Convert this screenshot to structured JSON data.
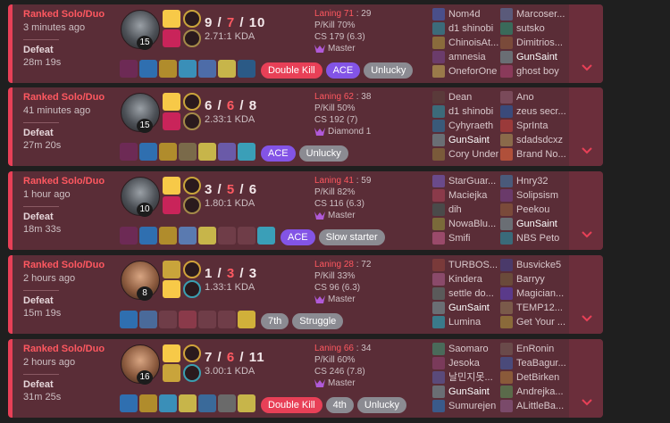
{
  "matches": [
    {
      "queue": "Ranked Solo/Duo",
      "ago": "3 minutes ago",
      "result": "Defeat",
      "duration": "28m 19s",
      "champ_style": "morde",
      "level": "15",
      "spells": [
        "#f7c948",
        "#c9245a"
      ],
      "runes": [
        "#c9a43b",
        "#a48a49"
      ],
      "kills": "9",
      "deaths": "7",
      "assists": "10",
      "kda_ratio": "2.71:1 KDA",
      "items": [
        "#6d2a55",
        "#2f6fb0",
        "#b08c2c",
        "#3a8fb8",
        "#4d6ca8",
        "#c7b54a",
        "#2b5a86"
      ],
      "badges": [
        {
          "label": "Double Kill",
          "color": "red"
        },
        {
          "label": "ACE",
          "color": "pur"
        },
        {
          "label": "Unlucky",
          "color": "gry"
        }
      ],
      "laning_label": "Laning",
      "laning_a": "71",
      "laning_b": "29",
      "pkill": "P/Kill 70%",
      "cs": "CS 179 (6.3)",
      "rank": "Master",
      "team1": [
        {
          "name": "Nom4d",
          "icon": "#4a4f8a"
        },
        {
          "name": "d1 shinobi",
          "icon": "#3c6b7a"
        },
        {
          "name": "ChinoisAt...",
          "icon": "#8a6b3c"
        },
        {
          "name": "amnesia",
          "icon": "#6b3c6b"
        },
        {
          "name": "OneforOne",
          "icon": "#9a7a4a"
        }
      ],
      "team2": [
        {
          "name": "Marcoser...",
          "icon": "#5a5a7a"
        },
        {
          "name": "sutsko",
          "icon": "#3a6a5a"
        },
        {
          "name": "Dimitrios...",
          "icon": "#7a4a3a"
        },
        {
          "name": "GunSaint",
          "icon": "#6a6e74",
          "me": true
        },
        {
          "name": "ghost boy",
          "icon": "#8a3a5a"
        }
      ]
    },
    {
      "queue": "Ranked Solo/Duo",
      "ago": "41 minutes ago",
      "result": "Defeat",
      "duration": "27m 20s",
      "champ_style": "morde",
      "level": "15",
      "spells": [
        "#f7c948",
        "#c9245a"
      ],
      "runes": [
        "#c9a43b",
        "#a48a49"
      ],
      "kills": "6",
      "deaths": "6",
      "assists": "8",
      "kda_ratio": "2.33:1 KDA",
      "items": [
        "#6d2a55",
        "#2f6fb0",
        "#b08c2c",
        "#7a6a4a",
        "#c7b54a",
        "#6a5aa8",
        "#3a9fb8"
      ],
      "badges": [
        {
          "label": "ACE",
          "color": "pur"
        },
        {
          "label": "Unlucky",
          "color": "gry"
        }
      ],
      "laning_label": "Laning",
      "laning_a": "62",
      "laning_b": "38",
      "pkill": "P/Kill 50%",
      "cs": "CS 192 (7)",
      "rank": "Diamond 1",
      "team1": [
        {
          "name": "Dean",
          "icon": "#5a3a3a"
        },
        {
          "name": "d1 shinobi",
          "icon": "#3c6b7a"
        },
        {
          "name": "Cyhyraeth",
          "icon": "#3a5a7a"
        },
        {
          "name": "GunSaint",
          "icon": "#6a6e74",
          "me": true
        },
        {
          "name": "Cory Under",
          "icon": "#7a5a3a"
        }
      ],
      "team2": [
        {
          "name": "Ano",
          "icon": "#7a4a5a"
        },
        {
          "name": "zeus secr...",
          "icon": "#3a4a7a"
        },
        {
          "name": "SprInta",
          "icon": "#9a3a3a"
        },
        {
          "name": "sdadsdcxz",
          "icon": "#8a6a4a"
        },
        {
          "name": "Brand No...",
          "icon": "#b0503a"
        }
      ]
    },
    {
      "queue": "Ranked Solo/Duo",
      "ago": "1 hour ago",
      "result": "Defeat",
      "duration": "18m 33s",
      "champ_style": "morde",
      "level": "10",
      "spells": [
        "#f7c948",
        "#c9245a"
      ],
      "runes": [
        "#c9a43b",
        "#a48a49"
      ],
      "kills": "3",
      "deaths": "5",
      "assists": "6",
      "kda_ratio": "1.80:1 KDA",
      "items": [
        "#6d2a55",
        "#2f6fb0",
        "#b08c2c",
        "#5a7ab0",
        "#c7b54a",
        "",
        "",
        "#3a9fb8"
      ],
      "badges": [
        {
          "label": "ACE",
          "color": "pur"
        },
        {
          "label": "Slow starter",
          "color": "gry"
        }
      ],
      "laning_label": "Laning",
      "laning_a": "41",
      "laning_b": "59",
      "pkill": "P/Kill 82%",
      "cs": "CS 116 (6.3)",
      "rank": "Master",
      "team1": [
        {
          "name": "StarGuar...",
          "icon": "#6a4a8a"
        },
        {
          "name": "Maciejka",
          "icon": "#8a3a4a"
        },
        {
          "name": "dih",
          "icon": "#4a4a4a"
        },
        {
          "name": "NowaBlu...",
          "icon": "#7a6a3a"
        },
        {
          "name": "Smifi",
          "icon": "#9a4a6a"
        }
      ],
      "team2": [
        {
          "name": "Hnry32",
          "icon": "#4a5a7a"
        },
        {
          "name": "Solipsism",
          "icon": "#6a3a6a"
        },
        {
          "name": "Peekou",
          "icon": "#7a4a3a"
        },
        {
          "name": "GunSaint",
          "icon": "#6a6e74",
          "me": true
        },
        {
          "name": "NBS Peto",
          "icon": "#3a6a7a"
        }
      ]
    },
    {
      "queue": "Ranked Solo/Duo",
      "ago": "2 hours ago",
      "result": "Defeat",
      "duration": "15m 19s",
      "champ_style": "lee",
      "level": "8",
      "spells": [
        "#c9a43b",
        "#f7c948"
      ],
      "runes": [
        "#d0a23a",
        "#3a9fb0"
      ],
      "kills": "1",
      "deaths": "3",
      "assists": "3",
      "kda_ratio": "1.33:1 KDA",
      "items": [
        "#2f6fb0",
        "#4a6a9a",
        "",
        "#8a3a4a",
        "",
        "",
        "#d0b03a"
      ],
      "badges": [
        {
          "label": "7th",
          "color": "gry"
        },
        {
          "label": "Struggle",
          "color": "gry"
        }
      ],
      "laning_label": "Laning",
      "laning_a": "28",
      "laning_b": "72",
      "pkill": "P/Kill 33%",
      "cs": "CS 96 (6.3)",
      "rank": "Master",
      "team1": [
        {
          "name": "TURBOS...",
          "icon": "#7a3a3a"
        },
        {
          "name": "Kindera",
          "icon": "#8a4a6a"
        },
        {
          "name": "settle do...",
          "icon": "#5a5a5a"
        },
        {
          "name": "GunSaint",
          "icon": "#6a6e74",
          "me": true
        },
        {
          "name": "Lumina",
          "icon": "#3a7a8a"
        }
      ],
      "team2": [
        {
          "name": "Busvicke5",
          "icon": "#4a3a6a"
        },
        {
          "name": "Barryy",
          "icon": "#6a4a3a"
        },
        {
          "name": "Magician...",
          "icon": "#5a3a8a"
        },
        {
          "name": "TEMP12...",
          "icon": "#7a5a4a"
        },
        {
          "name": "Get Your ...",
          "icon": "#8a6a3a"
        }
      ]
    },
    {
      "queue": "Ranked Solo/Duo",
      "ago": "2 hours ago",
      "result": "Defeat",
      "duration": "31m 25s",
      "champ_style": "lee",
      "level": "16",
      "spells": [
        "#f7c948",
        "#c9a43b"
      ],
      "runes": [
        "#d0a23a",
        "#3a9fb0"
      ],
      "kills": "7",
      "deaths": "6",
      "assists": "11",
      "kda_ratio": "3.00:1 KDA",
      "items": [
        "#2f6fb0",
        "#b08c2c",
        "#3a8fb8",
        "#c7b54a",
        "#3a6a9a",
        "#6a6a6a",
        "#c7b54a"
      ],
      "badges": [
        {
          "label": "Double Kill",
          "color": "red"
        },
        {
          "label": "4th",
          "color": "gry"
        },
        {
          "label": "Unlucky",
          "color": "gry"
        }
      ],
      "laning_label": "Laning",
      "laning_a": "66",
      "laning_b": "34",
      "pkill": "P/Kill 60%",
      "cs": "CS 246 (7.8)",
      "rank": "Master",
      "team1": [
        {
          "name": "Saomaro",
          "icon": "#4a6a5a"
        },
        {
          "name": "Jesoka",
          "icon": "#7a3a5a"
        },
        {
          "name": "날민지못...",
          "icon": "#5a4a7a"
        },
        {
          "name": "GunSaint",
          "icon": "#6a6e74",
          "me": true
        },
        {
          "name": "Sumurejen",
          "icon": "#3a5a8a"
        }
      ],
      "team2": [
        {
          "name": "EnRonin",
          "icon": "#6a4a4a"
        },
        {
          "name": "TeaBagur...",
          "icon": "#4a4a7a"
        },
        {
          "name": "DetBirken",
          "icon": "#8a5a3a"
        },
        {
          "name": "Andrejka...",
          "icon": "#5a6a4a"
        },
        {
          "name": "ALittleBa...",
          "icon": "#7a4a6a"
        }
      ]
    }
  ]
}
